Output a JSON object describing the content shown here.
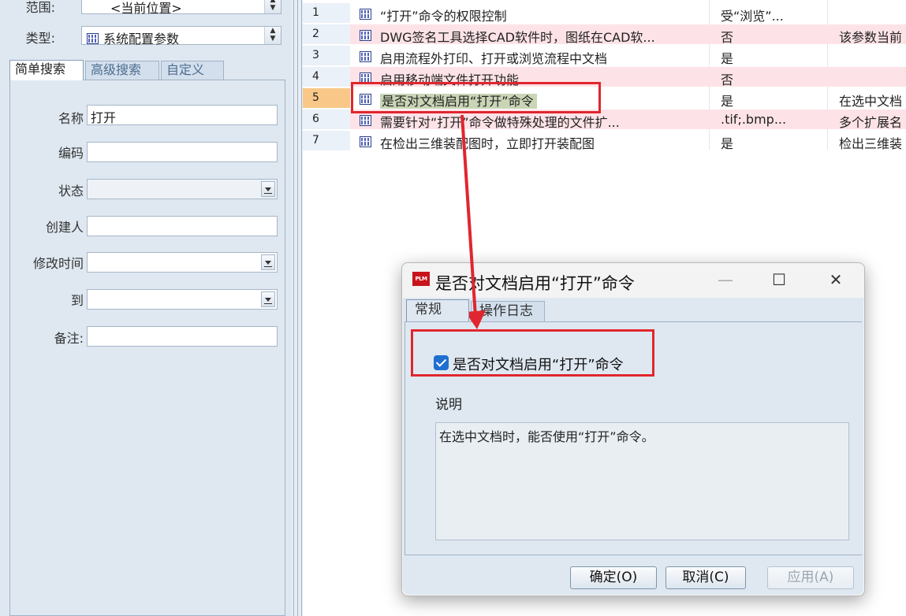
{
  "left": {
    "scope_label": "范围:",
    "scope_value": "<当前位置>",
    "type_label": "类型:",
    "type_value": "系统配置参数",
    "tabs": [
      {
        "label": "简单搜索"
      },
      {
        "label": "高级搜索"
      },
      {
        "label": "自定义"
      }
    ],
    "fields": {
      "name_label": "名称",
      "name_value": "打开",
      "code_label": "编码",
      "status_label": "状态",
      "creator_label": "创建人",
      "modified_label": "修改时间",
      "to_label": "到",
      "remark_label": "备注:"
    }
  },
  "table": {
    "rows": [
      {
        "num": "1",
        "name": "“打开”命令的权限控制",
        "value": "受“浏览”...",
        "desc": ""
      },
      {
        "num": "2",
        "name": "DWG签名工具选择CAD软件时，图纸在CAD软...",
        "value": "否",
        "desc": "该参数当前"
      },
      {
        "num": "3",
        "name": "启用流程外打印、打开或浏览流程中文档",
        "value": "是",
        "desc": ""
      },
      {
        "num": "4",
        "name": "启用移动端文件打开功能",
        "value": "否",
        "desc": ""
      },
      {
        "num": "5",
        "name": "是否对文档启用“打开”命令",
        "value": "是",
        "desc": "在选中文档"
      },
      {
        "num": "6",
        "name": "需要针对“打开”命令做特殊处理的文件扩...",
        "value": ".tif;.bmp...",
        "desc": "多个扩展名"
      },
      {
        "num": "7",
        "name": "在检出三维装配图时，立即打开装配图",
        "value": "是",
        "desc": "检出三维装"
      }
    ]
  },
  "dialog": {
    "logo": "PLM",
    "title": "是否对文档启用“打开”命令",
    "minimize": "—",
    "maximize": "☐",
    "close": "✕",
    "tabs": [
      {
        "label": "常规"
      },
      {
        "label": "操作日志"
      }
    ],
    "checkbox_label": "是否对文档启用“打开”命令",
    "desc_label": "说明",
    "desc_text": "在选中文档时，能否使用“打开”命令。",
    "ok": "确定(O)",
    "cancel": "取消(C)",
    "apply": "应用(A)"
  },
  "colors": {
    "highlight": "#e0262e",
    "selected_row": "#f9c888",
    "pink_row": "#fde3e7",
    "panel_bg": "#dfe8f1"
  }
}
